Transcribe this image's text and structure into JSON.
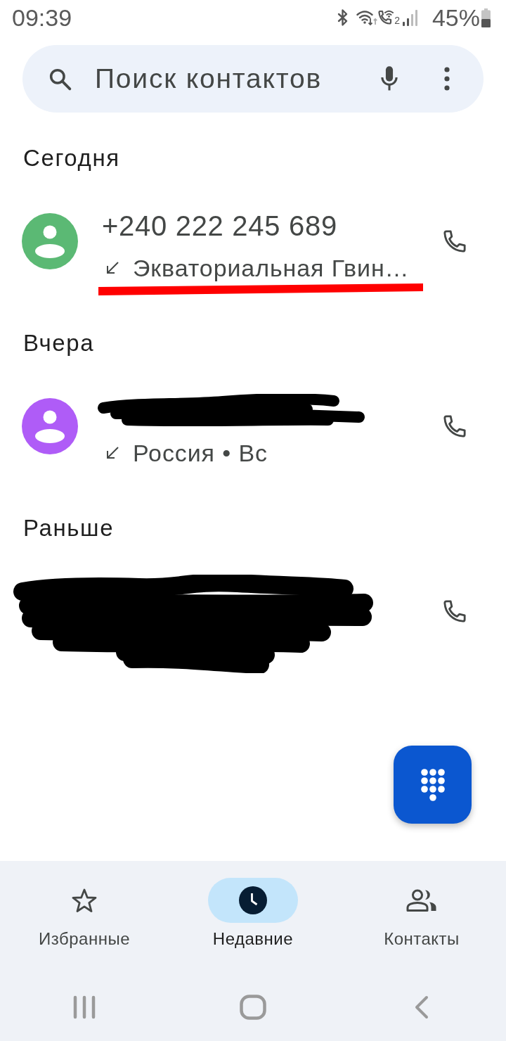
{
  "status_bar": {
    "time": "09:39",
    "call_sim_label": "2",
    "battery": "45%"
  },
  "search": {
    "placeholder": "Поиск контактов"
  },
  "sections": [
    {
      "title": "Сегодня",
      "calls": [
        {
          "kind": "plain",
          "number": "+240 222 245 689",
          "incoming": true,
          "detail": "Экваториальная Гвин…",
          "color": "#5bb974",
          "underlined": true
        }
      ]
    },
    {
      "title": "Вчера",
      "calls": [
        {
          "kind": "hidden-name",
          "incoming": true,
          "detail": "Россия • Вс",
          "color": "#af5cf7",
          "underlined": false
        }
      ]
    },
    {
      "title": "Раньше",
      "calls": [
        {
          "kind": "hidden-row"
        }
      ]
    }
  ],
  "nav": [
    {
      "kind": "favorites",
      "label": "Избранные",
      "selected": false
    },
    {
      "kind": "recents",
      "label": "Недавние",
      "selected": true
    },
    {
      "kind": "contacts",
      "label": "Контакты",
      "selected": false
    }
  ]
}
